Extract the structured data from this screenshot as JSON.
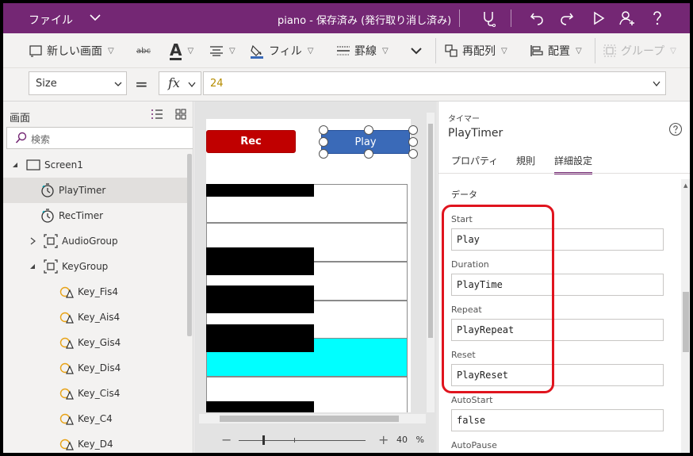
{
  "titlebar": {
    "file_menu": "ファイル",
    "title": "piano - 保存済み (発行取り消し済み)"
  },
  "ribbon": {
    "new_screen": "新しい画面",
    "strike": "abc",
    "font_color": "A",
    "fill": "フィル",
    "border": "罫線",
    "reorder": "再配列",
    "align": "配置",
    "group": "グループ"
  },
  "formula": {
    "property": "Size",
    "equals": "=",
    "fx_label": "fx",
    "value": "24"
  },
  "tree": {
    "header": "画面",
    "search_placeholder": "検索",
    "nodes": [
      {
        "label": "Screen1"
      },
      {
        "label": "PlayTimer"
      },
      {
        "label": "RecTimer"
      },
      {
        "label": "AudioGroup"
      },
      {
        "label": "KeyGroup"
      },
      {
        "label": "Key_Fis4"
      },
      {
        "label": "Key_Ais4"
      },
      {
        "label": "Key_Gis4"
      },
      {
        "label": "Key_Dis4"
      },
      {
        "label": "Key_Cis4"
      },
      {
        "label": "Key_C4"
      },
      {
        "label": "Key_D4"
      }
    ]
  },
  "canvas": {
    "rec_label": "Rec",
    "play_label": "Play",
    "lit_key_color": "#00ffff",
    "zoom_minus": "−",
    "zoom_plus": "+",
    "zoom_value": "40",
    "zoom_unit": "%"
  },
  "properties": {
    "kind": "タイマー",
    "control_name": "PlayTimer",
    "tabs": [
      "プロパティ",
      "規則",
      "詳細設定"
    ],
    "active_tab": "詳細設定",
    "section": "データ",
    "fields": [
      {
        "label": "Start",
        "value": "Play"
      },
      {
        "label": "Duration",
        "value": "PlayTime"
      },
      {
        "label": "Repeat",
        "value": "PlayRepeat"
      },
      {
        "label": "Reset",
        "value": "PlayReset"
      },
      {
        "label": "AutoStart",
        "value": "false"
      },
      {
        "label": "AutoPause",
        "value": ""
      }
    ],
    "highlight_color": "#e0141e"
  },
  "colors": {
    "titlebar": "#742774",
    "rec_button": "#c00000",
    "play_button": "#3a6ab8"
  }
}
